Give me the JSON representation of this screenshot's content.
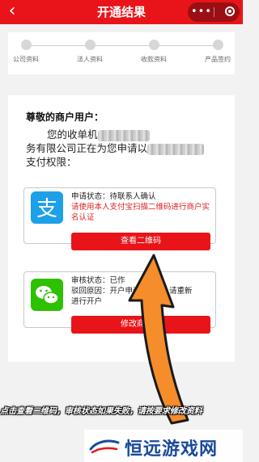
{
  "header": {
    "back_icon": "chevron-left-icon",
    "title": "开通结果",
    "more_label": "•••",
    "close_icon": "target-close-icon",
    "bg_color": "#e8141a"
  },
  "steps": [
    {
      "label": "公司资料"
    },
    {
      "label": "法人资料"
    },
    {
      "label": "收款资料"
    },
    {
      "label": "产品签约"
    }
  ],
  "result": {
    "greeting": "尊敬的商户用户：",
    "body_part1": "您的收单机",
    "body_part2": "务有限公司正在为您申请以",
    "body_part3": "支付权限："
  },
  "alipay": {
    "icon": "alipay-icon",
    "status": "申请状态：待联系人确认",
    "notice": "请使用本人支付宝扫描二维码进行商户实名认证",
    "button_label": "查看二维码"
  },
  "wechat": {
    "icon": "wechat-icon",
    "status": "审核状态：已作",
    "reason": "驳回原因：开户申请",
    "reason_tail": "，请重新",
    "line3": "进行开户",
    "button_label": "修改商户资"
  },
  "caption": "点击查看二维码，审核状态如果失败，请按要求修改资料",
  "watermark": {
    "text": "恒远游戏网"
  }
}
